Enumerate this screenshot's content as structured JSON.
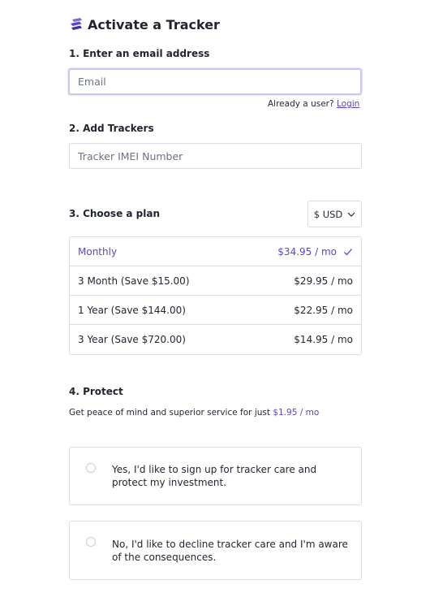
{
  "header": {
    "title": "Activate a Tracker",
    "logo_icon": "layers-logo-icon",
    "accent_color": "#5b45d0"
  },
  "step1": {
    "label": "1. Enter an email address",
    "email_placeholder": "Email",
    "email_value": "",
    "already_text": "Already a user?",
    "login_label": "Login"
  },
  "step2": {
    "label": "2. Add Trackers",
    "imei_placeholder": "Tracker IMEI Number",
    "imei_value": ""
  },
  "step3": {
    "label": "3. Choose a plan",
    "currency": "$ USD",
    "plans": [
      {
        "name": "Monthly",
        "price": "$34.95 / mo",
        "selected": true
      },
      {
        "name": "3 Month (Save $15.00)",
        "price": "$29.95 / mo",
        "selected": false
      },
      {
        "name": "1 Year (Save $144.00)",
        "price": "$22.95 / mo",
        "selected": false
      },
      {
        "name": "3 Year (Save $720.00)",
        "price": "$14.95 / mo",
        "selected": false
      }
    ]
  },
  "step4": {
    "label": "4. Protect",
    "description": "Get peace of mind and superior service for just",
    "price": "$1.95 / mo",
    "options": [
      {
        "line1": "Yes, I'd like to sign up for tracker care and",
        "line2": "protect my investment."
      },
      {
        "line1": "No, I'd like to decline tracker care and I'm aware",
        "line2": "of the consequences."
      }
    ]
  }
}
